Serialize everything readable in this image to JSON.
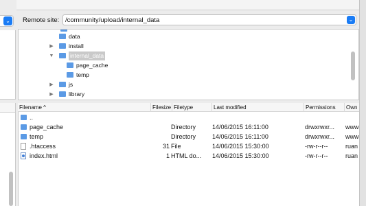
{
  "remote_site": {
    "label": "Remote site:",
    "path": "/community/upload/internal_data"
  },
  "tree": {
    "items": [
      {
        "label": "data",
        "expanded": null,
        "selected": false
      },
      {
        "label": "install",
        "expanded": false,
        "selected": false
      },
      {
        "label": "internal_data",
        "expanded": true,
        "selected": true
      },
      {
        "label": "page_cache",
        "expanded": null,
        "selected": false
      },
      {
        "label": "temp",
        "expanded": null,
        "selected": false
      },
      {
        "label": "js",
        "expanded": false,
        "selected": false
      },
      {
        "label": "library",
        "expanded": false,
        "selected": false
      }
    ]
  },
  "list": {
    "columns": {
      "filename": "Filename ^",
      "filesize": "Filesize",
      "filetype": "Filetype",
      "modified": "Last modified",
      "permissions": "Permissions",
      "owner": "Own"
    },
    "rows": [
      {
        "icon": "folder-icon",
        "name": "..",
        "size": "",
        "type": "",
        "modified": "",
        "perms": "",
        "owner": ""
      },
      {
        "icon": "folder-icon",
        "name": "page_cache",
        "size": "",
        "type": "Directory",
        "modified": "14/06/2015 16:11:00",
        "perms": "drwxrwxr...",
        "owner": "www"
      },
      {
        "icon": "folder-icon",
        "name": "temp",
        "size": "",
        "type": "Directory",
        "modified": "14/06/2015 16:11:00",
        "perms": "drwxrwxr...",
        "owner": "www"
      },
      {
        "icon": "file-icon",
        "name": ".htaccess",
        "size": "31",
        "type": "File",
        "modified": "14/06/2015 15:30:00",
        "perms": "-rw-r--r--",
        "owner": "ruan"
      },
      {
        "icon": "html-file-icon",
        "name": "index.html",
        "size": "1",
        "type": "HTML do...",
        "modified": "14/06/2015 15:30:00",
        "perms": "-rw-r--r--",
        "owner": "ruan"
      }
    ]
  },
  "colors": {
    "accent": "#1a7cf5",
    "folder": "#5b9ae5"
  }
}
